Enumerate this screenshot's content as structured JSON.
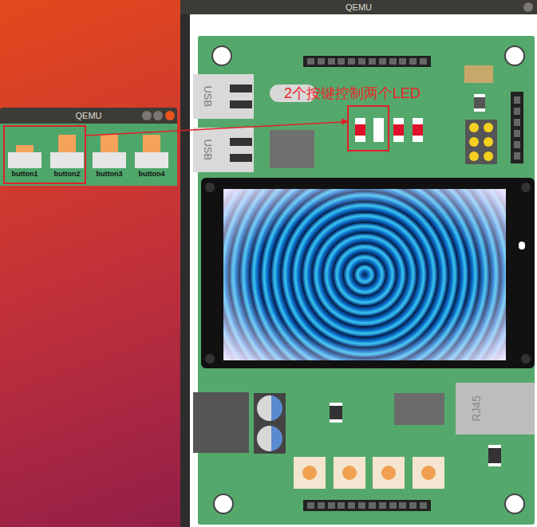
{
  "board_window": {
    "title": "QEMU",
    "usb_labels": [
      "USB",
      "USB"
    ],
    "annotation": "2个按键控制两个LED",
    "leds": [
      {
        "lit": false
      },
      {
        "lit": true
      },
      {
        "lit": false
      },
      {
        "lit": false
      }
    ],
    "rj45_label": "RJ45"
  },
  "button_window": {
    "title": "QEMU",
    "buttons": [
      {
        "label": "button1",
        "pressed": true
      },
      {
        "label": "button2",
        "pressed": false
      },
      {
        "label": "button3",
        "pressed": false
      },
      {
        "label": "button4",
        "pressed": false
      }
    ]
  }
}
